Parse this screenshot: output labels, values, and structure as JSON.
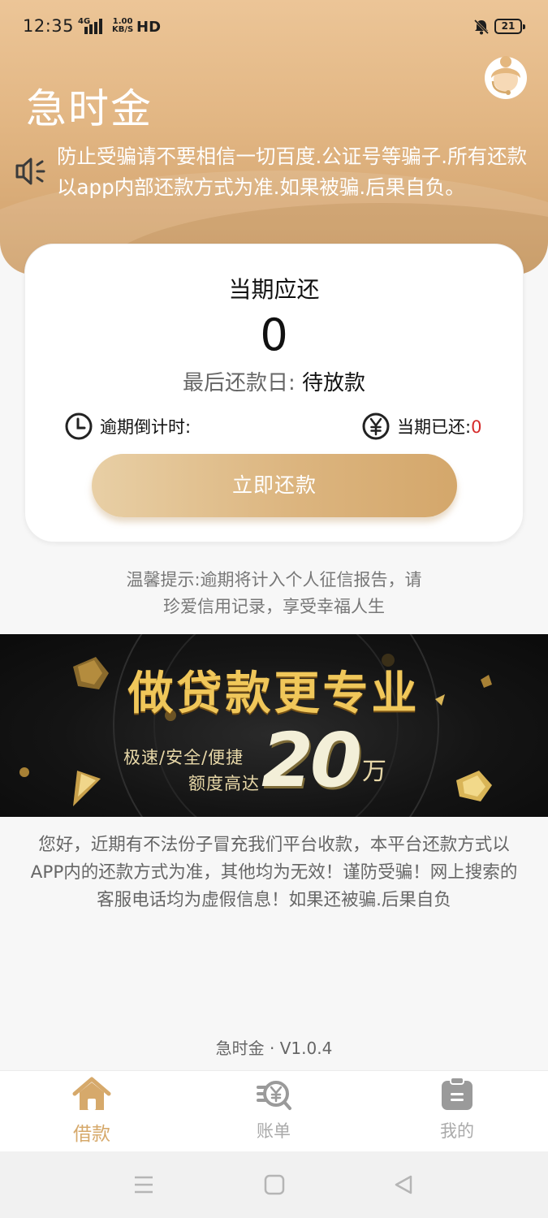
{
  "status_bar": {
    "time": "12:35",
    "network": "4G",
    "speed_value": "1.00",
    "speed_unit": "KB/S",
    "hd": "HD",
    "battery": "21"
  },
  "header": {
    "app_title": "急时金",
    "notice": "防止受骗请不要相信一切百度.公证号等骗子.所有还款以app内部还款方式为准.如果被骗.后果自负。"
  },
  "card": {
    "title": "当期应还",
    "amount": "0",
    "due_label": "最后还款日:",
    "due_value": "待放款",
    "overdue_label": "逾期倒计时:",
    "paid_label": "当期已还:",
    "paid_value": "0",
    "repay_button": "立即还款"
  },
  "tip": {
    "line1": "温馨提示:逾期将计入个人征信报告，请",
    "line2": "珍爱信用记录，享受幸福人生"
  },
  "banner": {
    "title": "做贷款更专业",
    "tags": "极速/安全/便捷",
    "limit_label": "额度高达",
    "amount": "20",
    "unit": "万"
  },
  "warning": {
    "line1": "您好，近期有不法份子冒充我们平台收款，本平台还款方式以",
    "line2": "APP内的还款方式为准，其他均为无效！谨防受骗！网上搜索的",
    "line3": "客服电话均为虚假信息！如果还被骗.后果自负"
  },
  "version": "急时金 · V1.0.4",
  "tabbar": {
    "items": [
      {
        "label": "借款",
        "icon": "home-icon",
        "active": true
      },
      {
        "label": "账单",
        "icon": "bill-icon",
        "active": false
      },
      {
        "label": "我的",
        "icon": "clipboard-icon",
        "active": false
      }
    ]
  },
  "colors": {
    "accent": "#d6a96b",
    "header_gradient_top": "#ecc597",
    "header_gradient_bottom": "#cfa06b",
    "paid_value": "#d62b2b",
    "banner_gold": "#f0c75a"
  }
}
